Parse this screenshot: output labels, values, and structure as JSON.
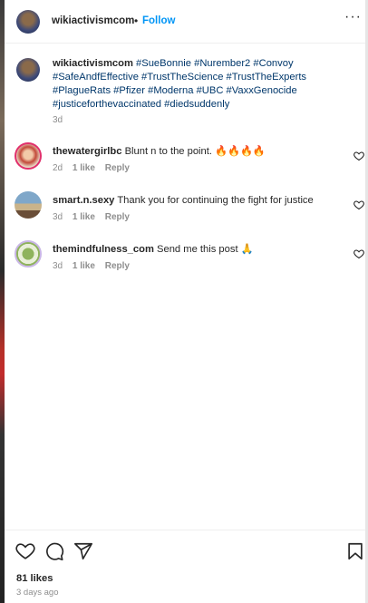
{
  "header": {
    "username": "wikiactivismcom",
    "dot": "•",
    "follow_label": "Follow",
    "more_label": "···"
  },
  "caption": {
    "username": "wikiactivismcom",
    "hashtags": "#SueBonnie #Nurember2 #Convoy #SafeAndfEffective #TrustTheScience #TrustTheExperts #PlagueRats #Pfizer #Moderna #UBC #VaxxGenocide #justiceforthevaccinated #diedsuddenly",
    "time": "3d"
  },
  "comments": [
    {
      "username": "thewatergirlbc",
      "text": "Blunt n to the point. 🔥🔥🔥🔥",
      "time": "2d",
      "likes": "1 like",
      "reply": "Reply"
    },
    {
      "username": "smart.n.sexy",
      "text": "Thank you for continuing the fight for justice",
      "time": "3d",
      "likes": "1 like",
      "reply": "Reply"
    },
    {
      "username": "themindfulness_com",
      "text": "Send me this post 🙏",
      "time": "3d",
      "likes": "1 like",
      "reply": "Reply"
    }
  ],
  "footer": {
    "likes": "81 likes",
    "ago": "3 days ago"
  },
  "icons": {
    "like": "heart-icon",
    "comment": "comment-icon",
    "share": "share-icon",
    "save": "bookmark-icon"
  },
  "colors": {
    "link_blue": "#0095f6",
    "hashtag": "#00376b",
    "muted": "#8e8e8e"
  }
}
